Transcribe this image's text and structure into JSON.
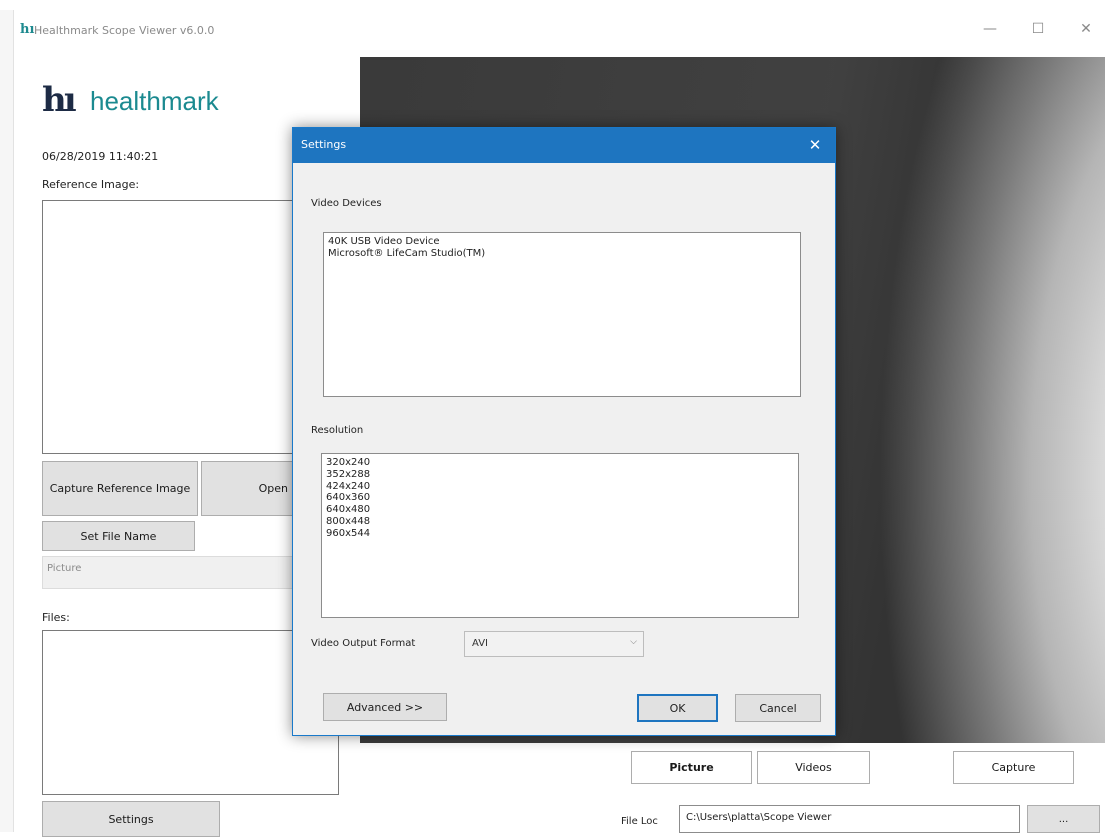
{
  "window": {
    "title": "Healthmark Scope Viewer v6.0.0",
    "icon_text": "hı",
    "minimize": "—",
    "maximize": "☐",
    "close": "✕"
  },
  "sidebar": {
    "logo_mark": "hı",
    "logo_text": "healthmark",
    "timestamp": "06/28/2019 11:40:21",
    "reference_label": "Reference Image:",
    "capture_reference_label": "Capture Reference Image",
    "open_label": "Open",
    "set_file_name_label": "Set File Name",
    "file_name_value": "Picture",
    "files_label": "Files:",
    "settings_label": "Settings"
  },
  "settings_dialog": {
    "title": "Settings",
    "close": "✕",
    "video_devices_label": "Video Devices",
    "video_devices": [
      "40K USB Video Device",
      "Microsoft® LifeCam Studio(TM)"
    ],
    "resolution_label": "Resolution",
    "resolutions": [
      "320x240",
      "352x288",
      "424x240",
      "640x360",
      "640x480",
      "800x448",
      "960x544"
    ],
    "output_format_label": "Video Output Format",
    "output_format_value": "AVI",
    "advanced_label": "Advanced >>",
    "ok_label": "OK",
    "cancel_label": "Cancel"
  },
  "bottom": {
    "picture_label": "Picture",
    "videos_label": "Videos",
    "capture_label": "Capture",
    "file_loc_label": "File Loc",
    "file_loc_value": "C:\\Users\\platta\\Scope Viewer",
    "browse_label": "..."
  },
  "colors": {
    "accent": "#1e75c0",
    "brand_teal": "#1b8a90",
    "brand_navy": "#1d2b45"
  }
}
